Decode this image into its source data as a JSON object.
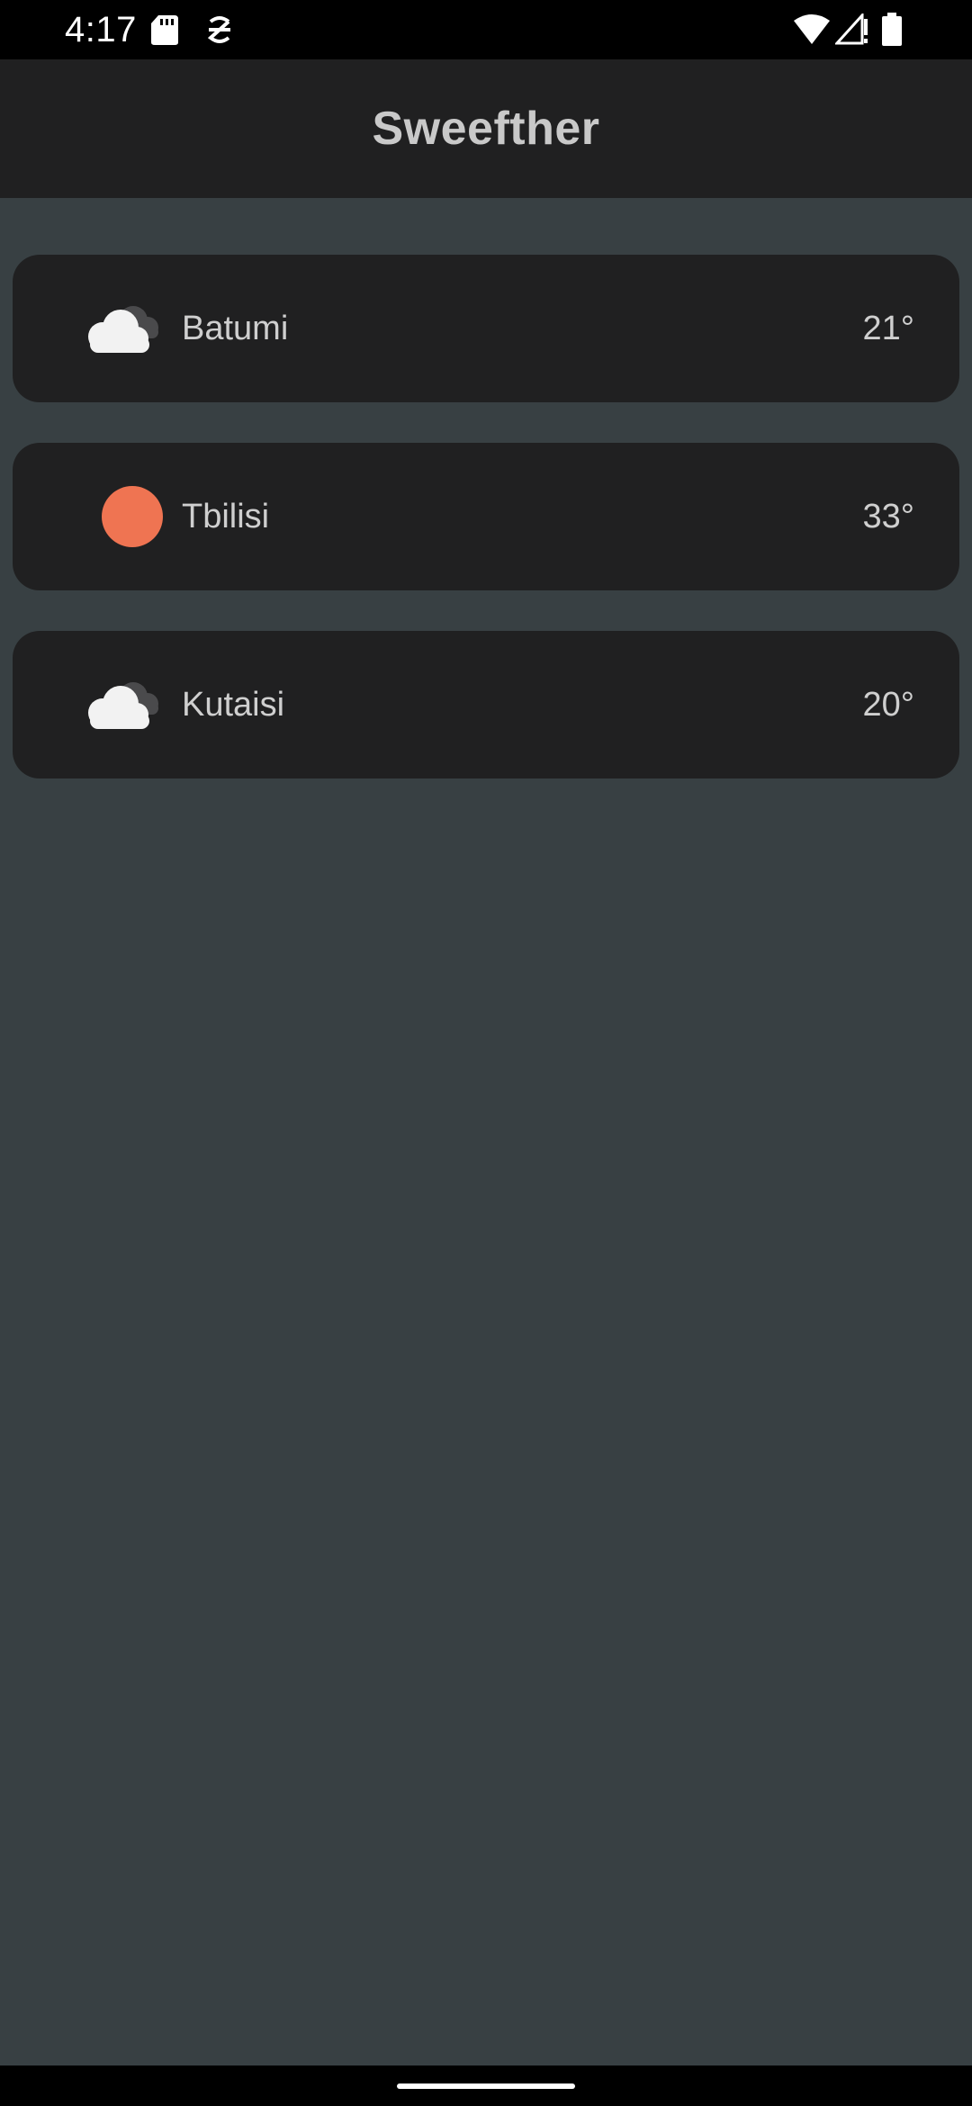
{
  "status_bar": {
    "time": "4:17",
    "icons": [
      "sd-card-icon",
      "debug-icon",
      "wifi-icon",
      "signal-icon",
      "battery-icon"
    ]
  },
  "app": {
    "title": "Sweefther"
  },
  "cities": [
    {
      "name": "Batumi",
      "temp": "21°",
      "icon": "cloudy-icon"
    },
    {
      "name": "Tbilisi",
      "temp": "33°",
      "icon": "sun-icon"
    },
    {
      "name": "Kutaisi",
      "temp": "20°",
      "icon": "cloudy-icon"
    }
  ],
  "colors": {
    "background": "#384043",
    "card": "#202021",
    "sun": "#ef7452",
    "cloud_front": "#f2f2f2",
    "cloud_back": "#4a4a4c"
  }
}
